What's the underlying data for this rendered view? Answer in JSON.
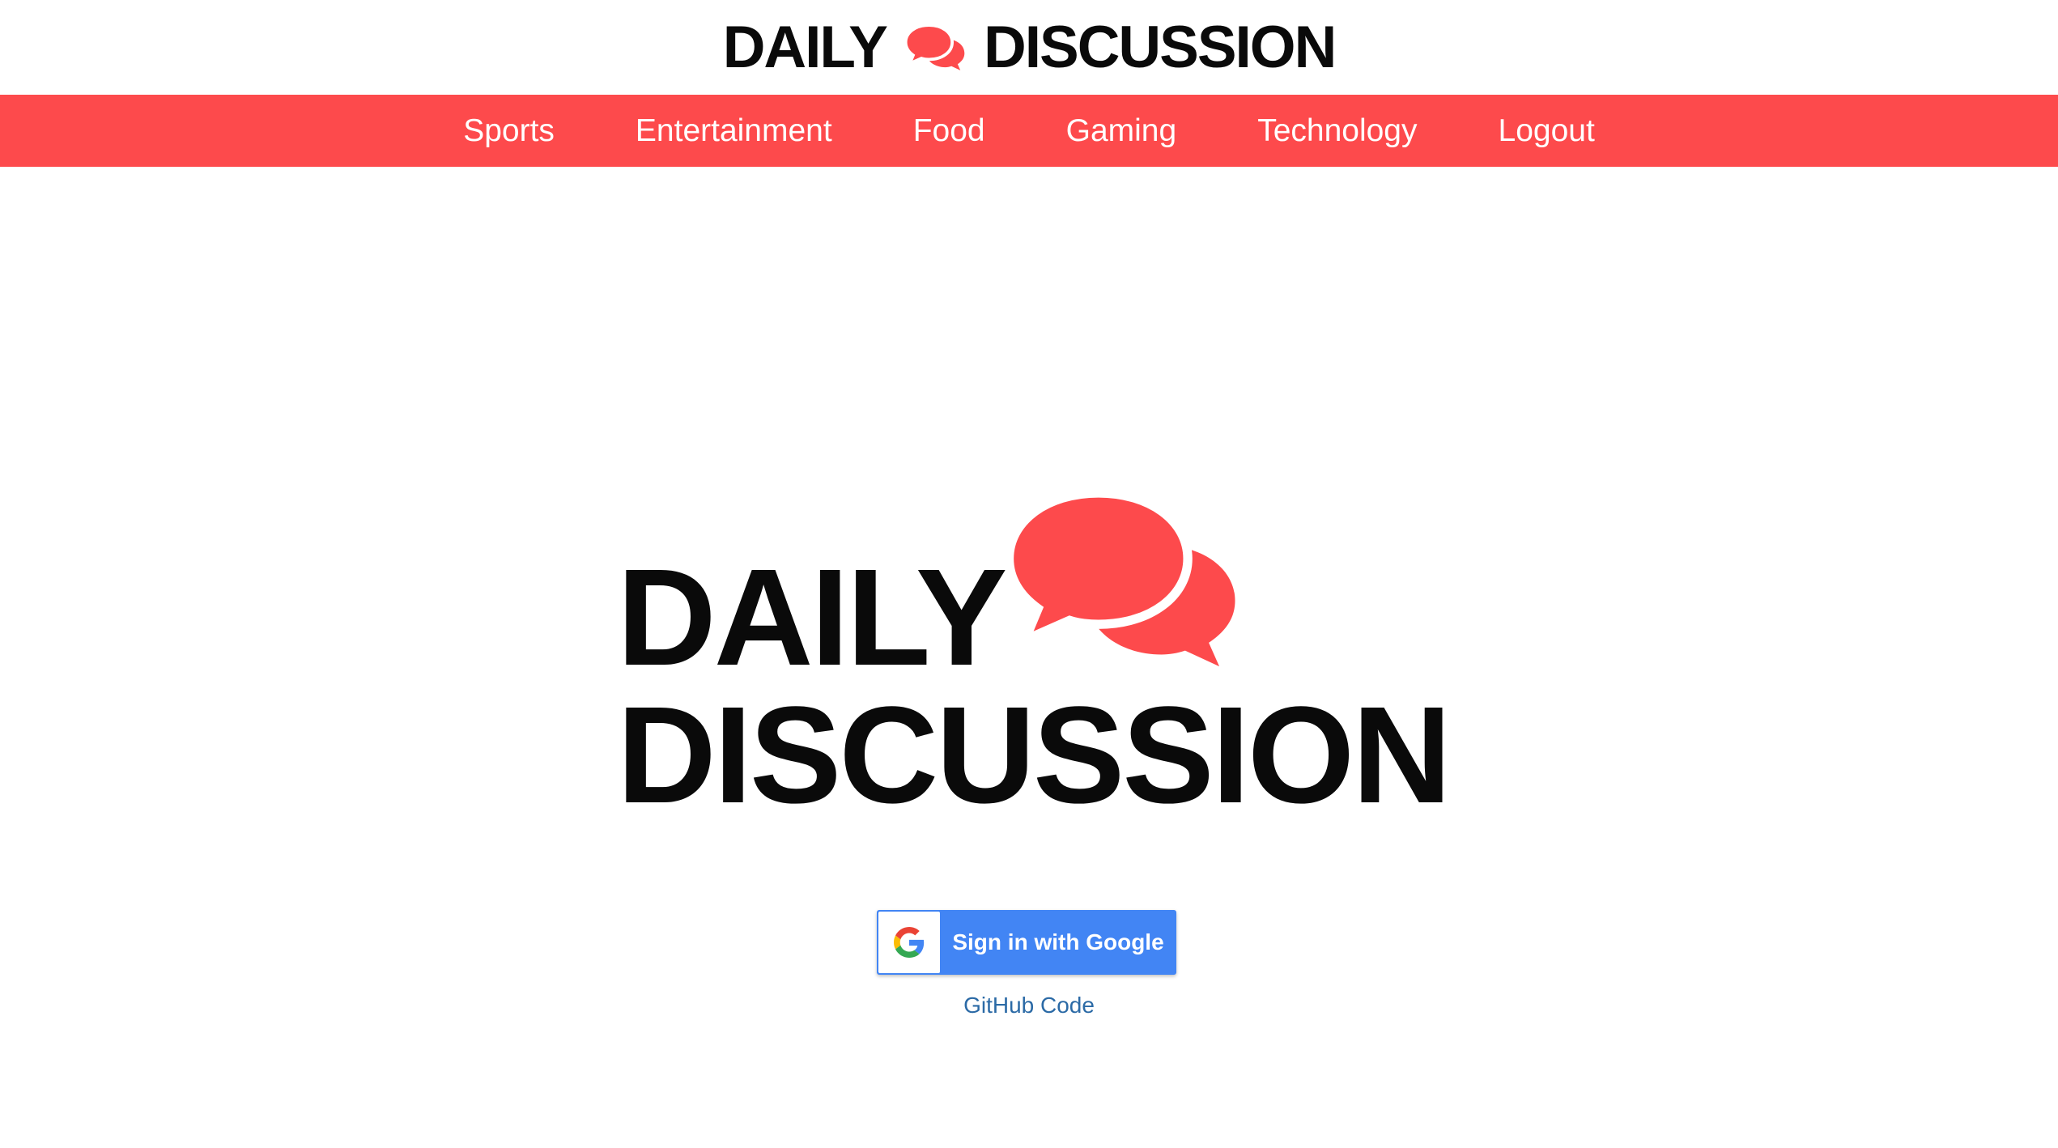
{
  "header": {
    "logo_word1": "DAILY",
    "logo_word2": "DISCUSSION",
    "logo_icon": "speech-bubbles-icon"
  },
  "nav": {
    "items": [
      {
        "label": "Sports"
      },
      {
        "label": "Entertainment"
      },
      {
        "label": "Food"
      },
      {
        "label": "Gaming"
      },
      {
        "label": "Technology"
      },
      {
        "label": "Logout"
      }
    ]
  },
  "hero": {
    "line1": "DAILY",
    "line2": "DISCUSSION",
    "icon": "speech-bubbles-icon"
  },
  "signin": {
    "label": "Sign in with Google",
    "icon": "google-g-icon"
  },
  "footer": {
    "github_link": "GitHub Code"
  },
  "colors": {
    "brand_red": "#fd4a4c",
    "google_blue": "#4285f4",
    "link_blue": "#2b6aa6",
    "text_black": "#0a0a0a"
  }
}
